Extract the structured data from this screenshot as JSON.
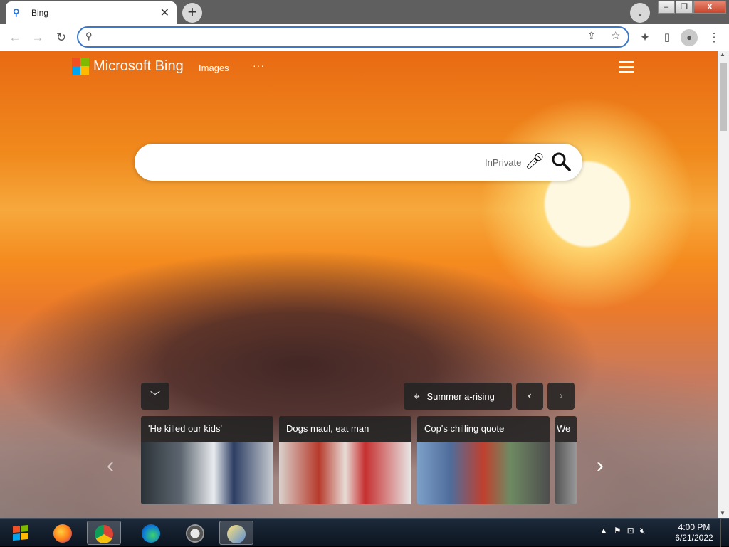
{
  "browser": {
    "tab_title": "Bing",
    "address_value": "",
    "colors": {
      "accent": "#3b78c8"
    }
  },
  "bing": {
    "brand": "Microsoft Bing",
    "nav_images": "Images",
    "nav_more": "···",
    "search": {
      "value": "",
      "inprivate": "InPrivate"
    },
    "location_label": "Summer a-rising",
    "news": [
      {
        "caption": "'He killed our kids'"
      },
      {
        "caption": "Dogs maul, eat man"
      },
      {
        "caption": "Cop's chilling quote"
      },
      {
        "caption": "We"
      }
    ]
  },
  "taskbar": {
    "time": "4:00 PM",
    "date": "6/21/2022"
  }
}
